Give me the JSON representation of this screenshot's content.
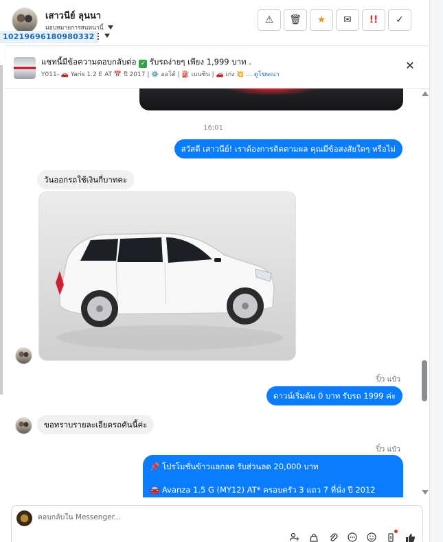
{
  "header": {
    "contact_name": "เสาวนีย์ ลุนนา",
    "assignment_label": "มอบหมายการสนทนานี้",
    "conversation_id": "10219696180980332",
    "actions": [
      {
        "name": "spam",
        "glyph": "⚠"
      },
      {
        "name": "delete",
        "glyph": "🗑"
      },
      {
        "name": "star",
        "glyph": "★"
      },
      {
        "name": "mark-unread",
        "glyph": "✉"
      },
      {
        "name": "follow-up",
        "glyph": "!!"
      },
      {
        "name": "done",
        "glyph": "✓"
      }
    ]
  },
  "ad_banner": {
    "title": "แชทนี้มีข้อความตอบกลับต่อ",
    "check_glyph": "✓",
    "title_suffix": "รับรถง่ายๆ เพียง 1,999 บาท .",
    "meta": "Y011- 🚗 Yaris 1.2 E AT 📅 ปี 2017 | ⚙️ ออโต้ | ⛽ เบนซิน | 🚗 เก่ง 💥 ...",
    "link_text": "ดูโฆษณา",
    "close_glyph": "✕"
  },
  "chat": {
    "timestamp": "16:01",
    "messages": [
      {
        "dir": "out",
        "text": "สวัสดี เสาวนีย์! เราต้องการติดตามผล คุณมีข้อสงสัยใดๆ หรือไม่"
      },
      {
        "dir": "in",
        "text": "วันออกรถใช้เงินกี่บาทคะ"
      },
      {
        "dir": "out",
        "sender": "ปิ๋ว แป๋ว",
        "text": "ดาวน์เริ่มต้น 0 บาท รับรถ 1999 ค่ะ"
      },
      {
        "dir": "in",
        "text": "ขอทราบรายละเอียดรถคันนี้ค่ะ"
      },
      {
        "dir": "out",
        "sender": "ปิ๋ว แป๋ว",
        "lines": [
          "📌 โปรโมชั่นข้าวแลกลด รับส่วนลด 20,000 บาท",
          "🚘 Avanza 1.5 G (MY12) AT* ครอบครัว 3 แถว 7 ที่นั่ง ปี 2012"
        ]
      }
    ]
  },
  "composer": {
    "placeholder": "ตอบกลับใน Messenger...",
    "icons": [
      "add-person-icon",
      "bag-icon",
      "attach-icon",
      "more-icon",
      "emoji-icon",
      "dropper-icon",
      "like-icon"
    ]
  },
  "colors": {
    "outgoing_bubble": "#0a7cff",
    "incoming_bubble": "#f0f0f0",
    "star": "#e8952d",
    "urgent": "#e0282e"
  }
}
